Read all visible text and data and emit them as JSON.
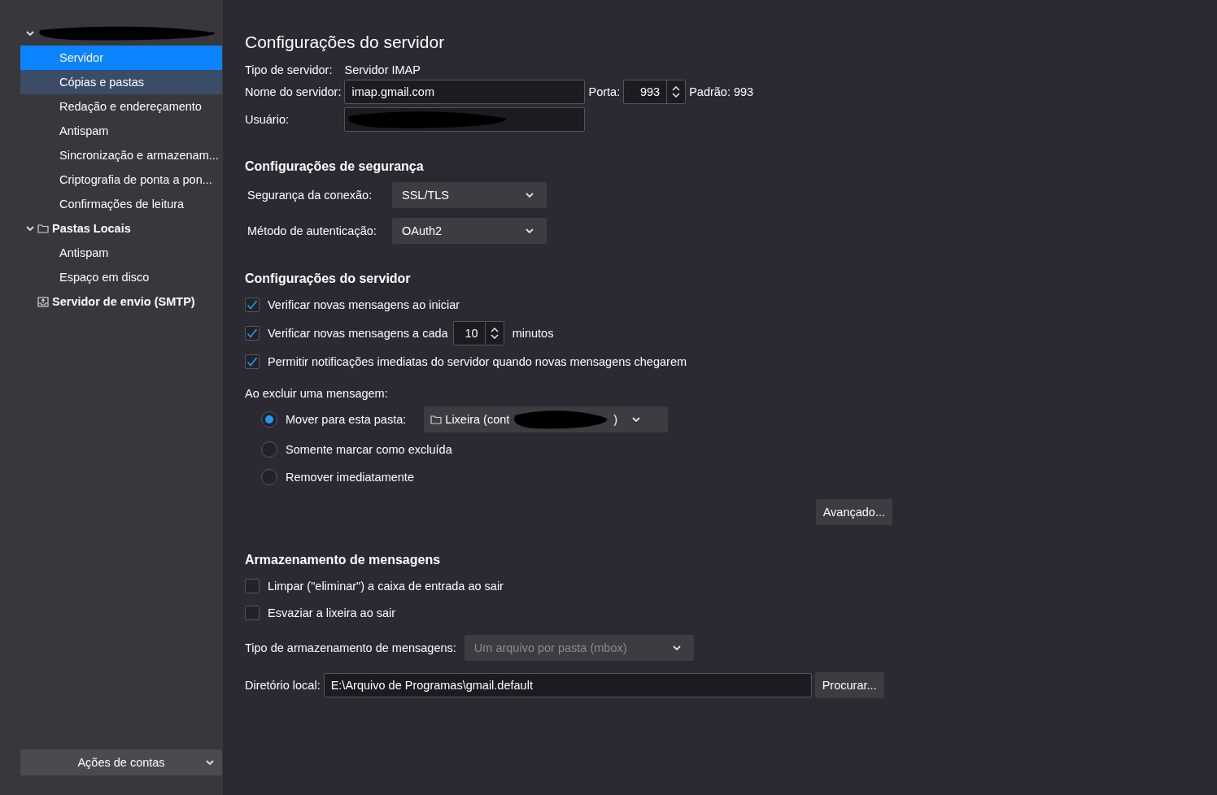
{
  "sidebar": {
    "tree": [
      {
        "kind": "account",
        "redacted": true,
        "expanded": true,
        "children": [
          {
            "label": "Servidor",
            "selected": true,
            "highlighted": false
          },
          {
            "label": "Cópias e pastas",
            "selected": false,
            "highlighted": true
          },
          {
            "label": "Redação e endereçamento",
            "selected": false,
            "highlighted": false
          },
          {
            "label": "Antispam",
            "selected": false,
            "highlighted": false
          },
          {
            "label": "Sincronização e armazenam...",
            "selected": false,
            "highlighted": false
          },
          {
            "label": "Criptografia de ponta a pon...",
            "selected": false,
            "highlighted": false
          },
          {
            "label": "Confirmações de leitura",
            "selected": false,
            "highlighted": false
          }
        ]
      },
      {
        "kind": "folder",
        "label": "Pastas Locais",
        "expanded": true,
        "children": [
          {
            "label": "Antispam",
            "selected": false,
            "highlighted": false
          },
          {
            "label": "Espaço em disco",
            "selected": false,
            "highlighted": false
          }
        ]
      },
      {
        "kind": "outgoing",
        "label": "Servidor de envio (SMTP)"
      }
    ],
    "account_actions": "Ações de contas"
  },
  "main": {
    "title": "Configurações do servidor",
    "server_type": {
      "label": "Tipo de servidor:",
      "value": "Servidor IMAP"
    },
    "server_name": {
      "label": "Nome do servidor:",
      "value": "imap.gmail.com"
    },
    "port": {
      "label": "Porta:",
      "value": "993",
      "default": "Padrão: 993"
    },
    "user": {
      "label": "Usuário:",
      "redacted": true
    },
    "security": {
      "heading": "Configurações de segurança",
      "fields": [
        {
          "label": "Segurança da conexão:",
          "value": "SSL/TLS"
        },
        {
          "label": "Método de autenticação:",
          "value": "OAuth2"
        }
      ]
    },
    "server_settings": {
      "heading": "Configurações do servidor",
      "options": [
        {
          "kind": "check",
          "label": "Verificar novas mensagens ao iniciar",
          "checked": true
        },
        {
          "kind": "interval",
          "label": "Verificar novas mensagens a cada",
          "checked": true,
          "value": "10",
          "unit": "minutos"
        },
        {
          "kind": "check",
          "label": "Permitir notificações imediatas do servidor quando novas mensagens chegarem",
          "checked": true
        }
      ],
      "delete_label": "Ao excluir uma mensagem:",
      "delete_options": [
        {
          "label": "Mover para esta pasta:",
          "selected": true,
          "folder": {
            "value": "Lixeira (cont",
            "tail": ")",
            "redacted": true
          }
        },
        {
          "label": "Somente marcar como excluída",
          "selected": false
        },
        {
          "label": "Remover imediatamente",
          "selected": false
        }
      ],
      "advanced": "Avançado..."
    },
    "storage": {
      "heading": "Armazenamento de mensagens",
      "options": [
        {
          "kind": "check",
          "label": "Limpar (\"eliminar\") a caixa de entrada ao sair",
          "checked": false
        },
        {
          "kind": "check",
          "label": "Esvaziar a lixeira ao sair",
          "checked": false
        }
      ],
      "store_type": {
        "label": "Tipo de armazenamento de mensagens:",
        "value": "Um arquivo por pasta (mbox)",
        "disabled": true
      },
      "local_dir": {
        "label": "Diretório local:",
        "value": "E:\\Arquivo de Programas\\gmail.default"
      },
      "browse": "Procurar..."
    }
  }
}
